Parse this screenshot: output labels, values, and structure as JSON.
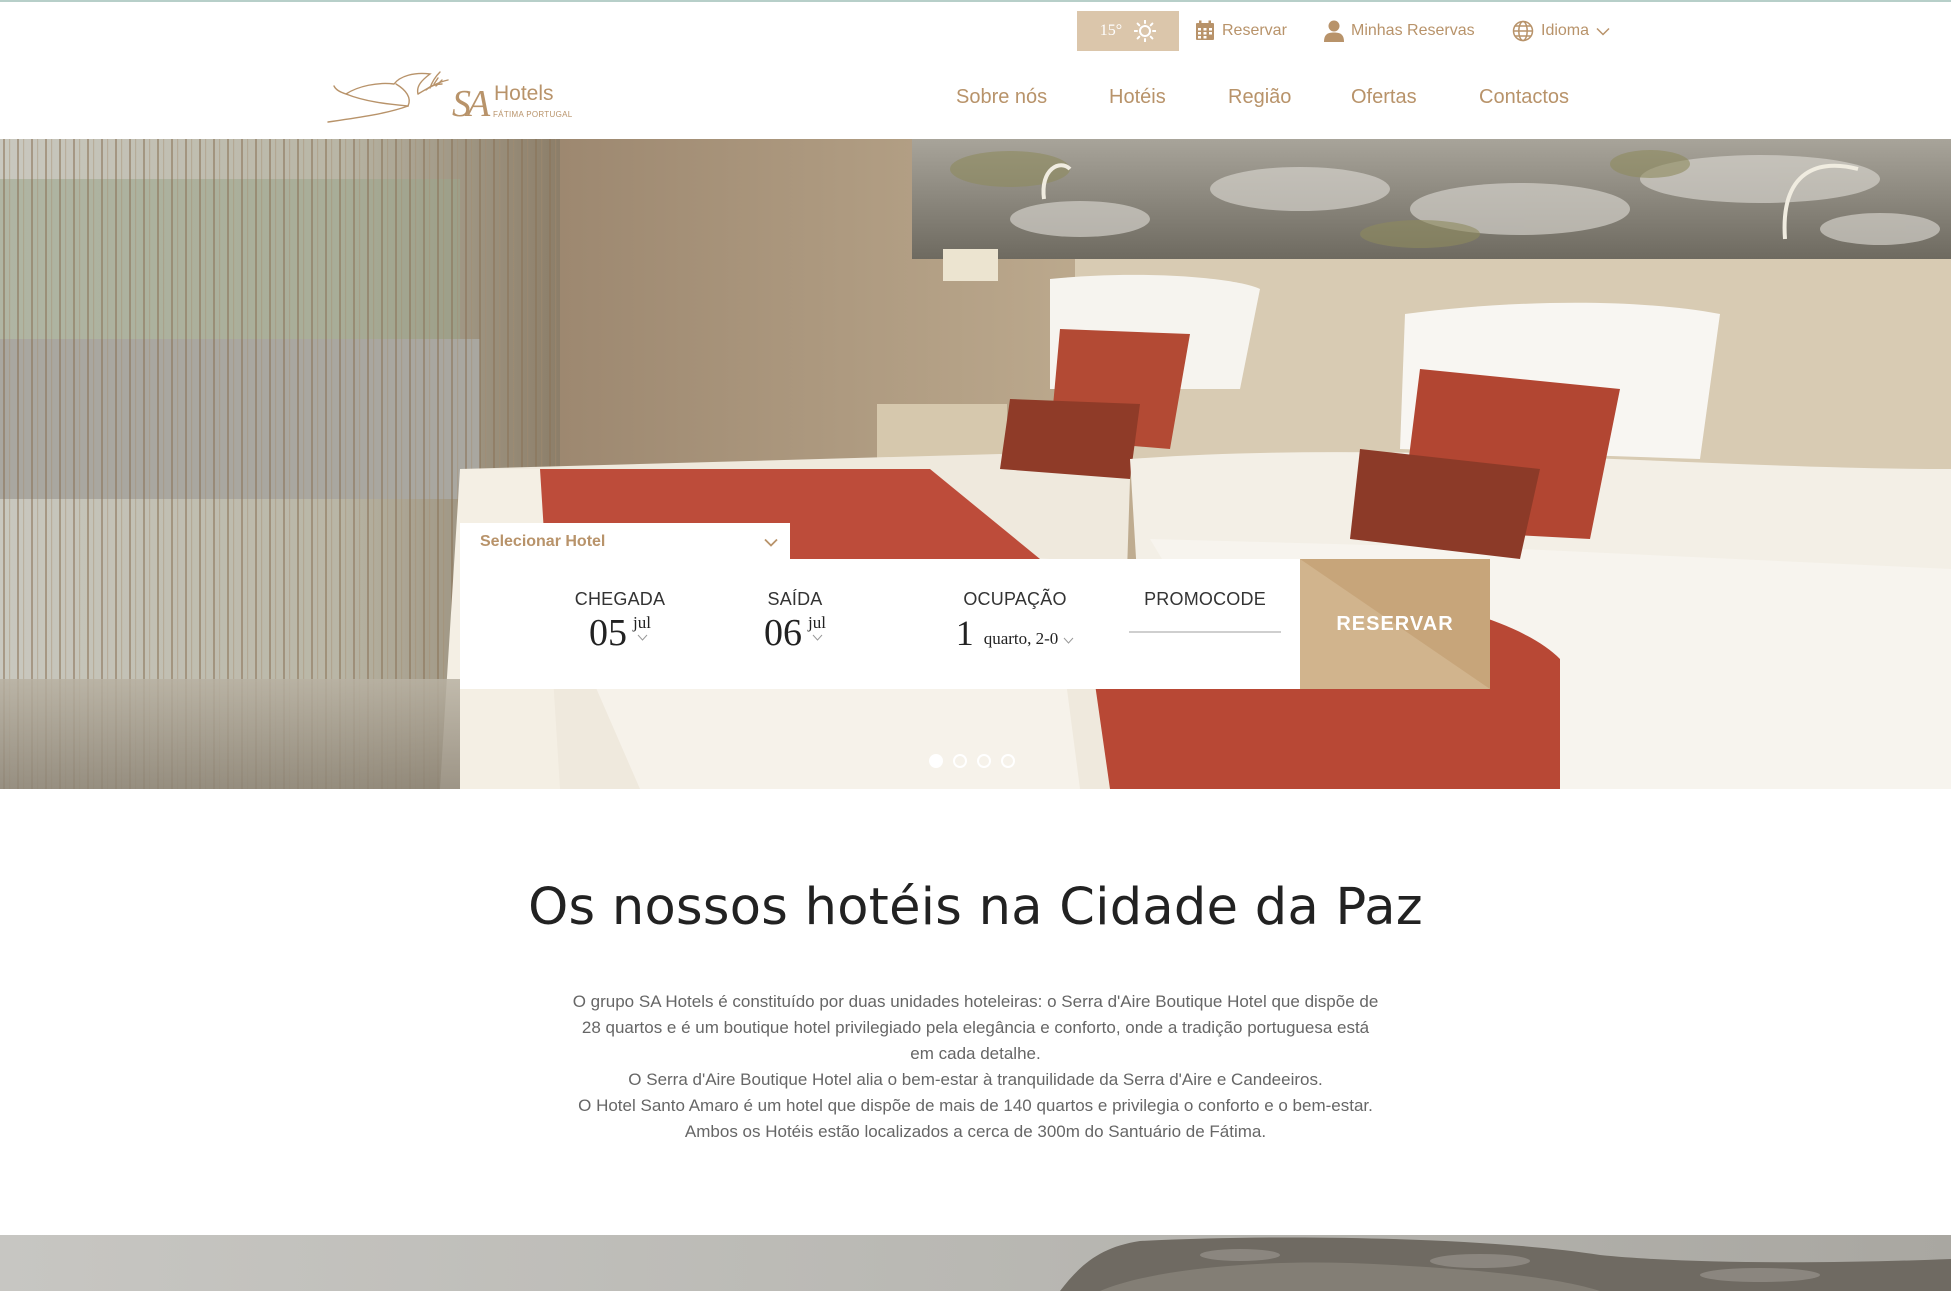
{
  "topbar": {
    "temperature": "15°",
    "reservar": "Reservar",
    "minhas_reservas": "Minhas Reservas",
    "idioma": "Idioma"
  },
  "logo": {
    "name": "Hotels",
    "tagline": "FÁTIMA PORTUGAL"
  },
  "nav": {
    "items": [
      {
        "label": "Sobre nós"
      },
      {
        "label": "Hotéis"
      },
      {
        "label": "Região"
      },
      {
        "label": "Ofertas"
      },
      {
        "label": "Contactos"
      }
    ]
  },
  "booking": {
    "hotel_select": "Selecionar Hotel",
    "checkin": {
      "label": "CHEGADA",
      "day": "05",
      "month": "jul"
    },
    "checkout": {
      "label": "SAÍDA",
      "day": "06",
      "month": "jul"
    },
    "occupancy": {
      "label": "OCUPAÇÃO",
      "count": "1",
      "detail": "quarto, 2-0"
    },
    "promocode": {
      "label": "PROMOCODE",
      "value": ""
    },
    "submit": "RESERVAR"
  },
  "carousel": {
    "slides": 4,
    "active": 1
  },
  "content": {
    "headline": "Os nossos hotéis na Cidade da Paz",
    "paragraph_lines": [
      "O grupo SA Hotels é constituído por duas unidades hoteleiras: o Serra d'Aire Boutique Hotel que dispõe de",
      "28 quartos e é um boutique hotel privilegiado pela elegância e conforto, onde a tradição portuguesa está",
      "em cada detalhe.",
      "O Serra d'Aire Boutique Hotel alia o bem-estar à tranquilidade da Serra d'Aire e Candeeiros.",
      "O Hotel Santo Amaro é um hotel que dispõe de mais de 140 quartos e privilegia o conforto e o bem-estar.",
      "Ambos os Hotéis estão localizados a cerca de 300m do Santuário de Fátima."
    ]
  },
  "colors": {
    "accent": "#b8936a",
    "weather_bg": "#dbc6ab",
    "button": "#c7a57a"
  }
}
